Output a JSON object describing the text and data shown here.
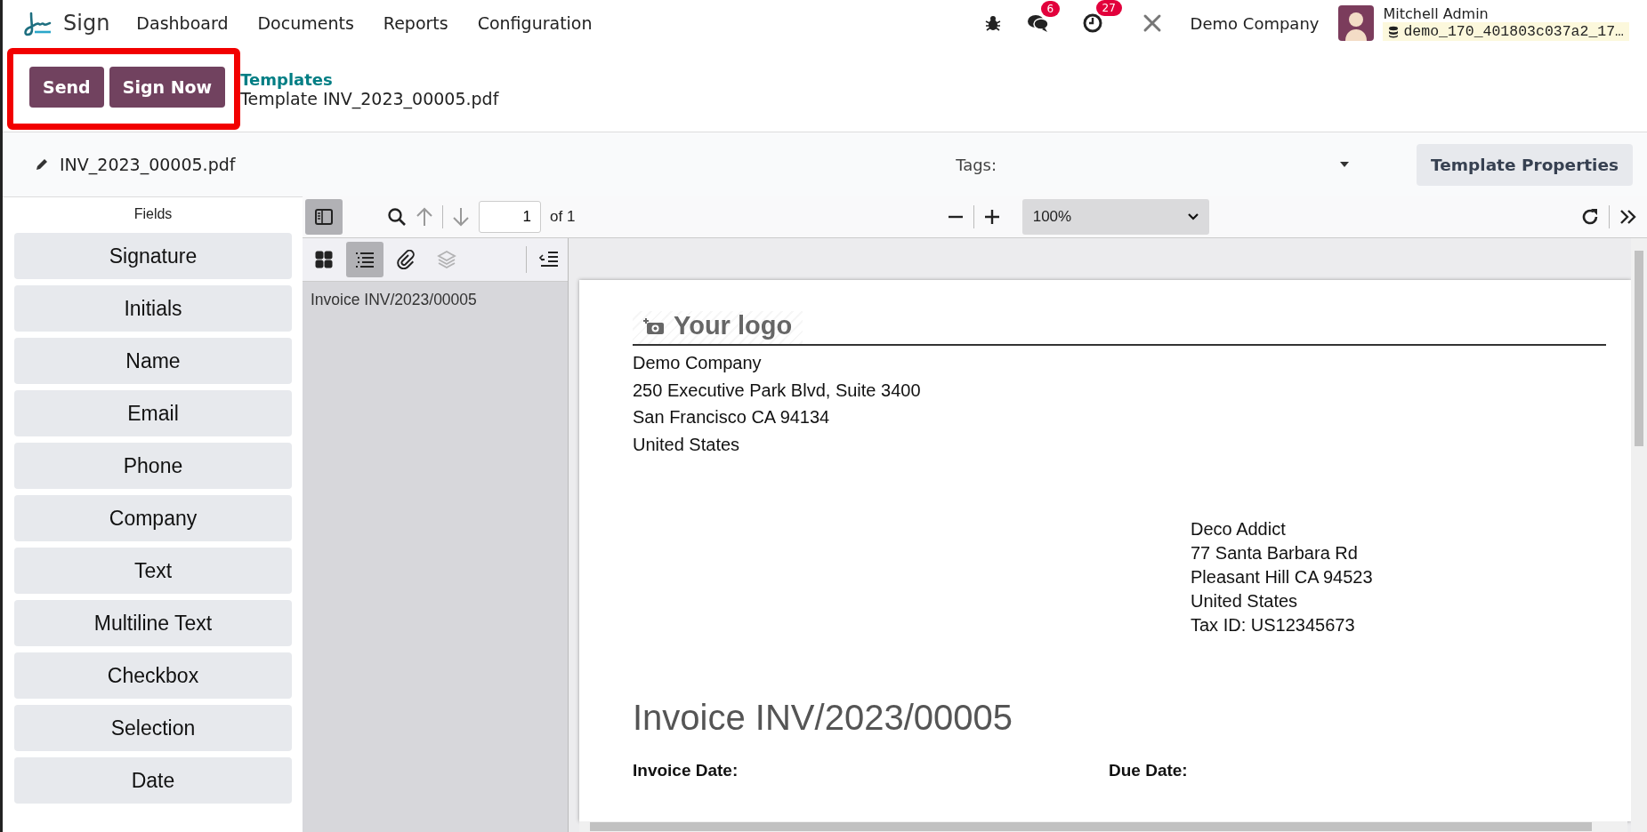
{
  "app": {
    "name": "Sign"
  },
  "menu": [
    "Dashboard",
    "Documents",
    "Reports",
    "Configuration"
  ],
  "systray": {
    "messages_count": "6",
    "activities_count": "27",
    "company": "Demo Company",
    "user": "Mitchell Admin",
    "database": "demo_170_401803c037a2_17…"
  },
  "actions": {
    "highlighted": true,
    "buttons": [
      "Send",
      "Sign Now"
    ]
  },
  "breadcrumb": {
    "parent": "Templates",
    "current": "Template INV_2023_00005.pdf"
  },
  "document_bar": {
    "filename": "INV_2023_00005.pdf",
    "tags_label": "Tags:",
    "properties_button": "Template Properties"
  },
  "fields_panel": {
    "title": "Fields",
    "items": [
      "Signature",
      "Initials",
      "Name",
      "Email",
      "Phone",
      "Company",
      "Text",
      "Multiline Text",
      "Checkbox",
      "Selection",
      "Date"
    ]
  },
  "viewer": {
    "page": "1",
    "page_count": "of 1",
    "zoom": "100%",
    "sidebar_tabs": [
      {
        "kind": "thumbnails",
        "selected": false,
        "disabled": false
      },
      {
        "kind": "outline",
        "selected": true,
        "disabled": false
      },
      {
        "kind": "attachments",
        "selected": false,
        "disabled": false
      },
      {
        "kind": "layers",
        "selected": false,
        "disabled": true
      }
    ],
    "outline": [
      "Invoice INV/2023/00005"
    ]
  },
  "document": {
    "logo": "Your logo",
    "company_address": [
      "Demo Company",
      "250 Executive Park Blvd, Suite 3400",
      "San Francisco CA 94134",
      "United States"
    ],
    "customer_address": [
      "Deco Addict",
      "77 Santa Barbara Rd",
      "Pleasant Hill CA 94523",
      "United States",
      "Tax ID: US12345673"
    ],
    "title": "Invoice INV/2023/00005",
    "labels": [
      "Invoice Date:",
      "Due Date:"
    ]
  }
}
